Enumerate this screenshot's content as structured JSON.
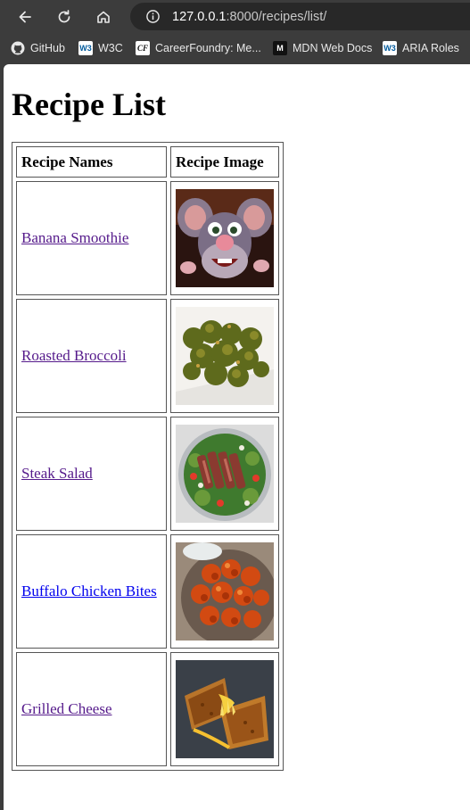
{
  "browser": {
    "url_host": "127.0.0.1",
    "url_rest": ":8000/recipes/list/",
    "bookmarks": [
      {
        "label": "GitHub",
        "icon": "github-icon"
      },
      {
        "label": "W3C",
        "icon": "w3c-icon"
      },
      {
        "label": "CareerFoundry: Me...",
        "icon": "careerfoundry-icon"
      },
      {
        "label": "MDN Web Docs",
        "icon": "mdn-icon"
      },
      {
        "label": "ARIA Roles",
        "icon": "w3c-icon"
      }
    ]
  },
  "page": {
    "title": "Recipe List",
    "table": {
      "headers": [
        "Recipe Names",
        "Recipe Image"
      ],
      "rows": [
        {
          "name": "Banana Smoothie",
          "visited": true,
          "image": "ratatouille-rat-image"
        },
        {
          "name": "Roasted Broccoli",
          "visited": true,
          "image": "roasted-broccoli-image"
        },
        {
          "name": "Steak Salad",
          "visited": true,
          "image": "steak-salad-image"
        },
        {
          "name": "Buffalo Chicken Bites",
          "visited": false,
          "image": "buffalo-chicken-image"
        },
        {
          "name": "Grilled Cheese",
          "visited": true,
          "image": "grilled-cheese-image"
        }
      ]
    }
  },
  "colors": {
    "visited_link": "#551a8b",
    "unvisited_link": "#0000ee",
    "chrome_bg": "#3c3c3c"
  }
}
